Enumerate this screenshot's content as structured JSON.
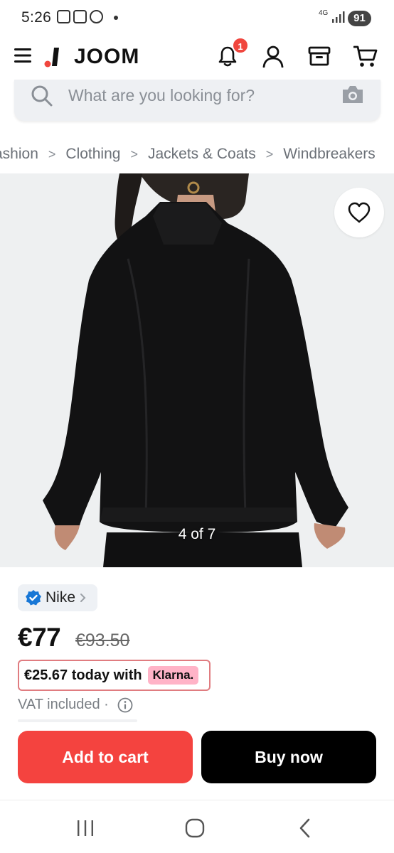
{
  "status_bar": {
    "time": "5:26",
    "network": "4G",
    "battery": "91"
  },
  "header": {
    "brand": "JOOM",
    "notification_count": "1"
  },
  "search": {
    "placeholder": "What are you looking for?"
  },
  "breadcrumbs": [
    "ashion",
    "Clothing",
    "Jackets & Coats",
    "Windbreakers"
  ],
  "gallery": {
    "counter": "4 of 7"
  },
  "product": {
    "brand": "Nike",
    "price": "€77",
    "old_price": "€93.50",
    "klarna_text": "€25.67 today with",
    "klarna_badge": "Klarna.",
    "vat_text": "VAT included ·"
  },
  "actions": {
    "add_to_cart": "Add to cart",
    "buy_now": "Buy now"
  },
  "colors": {
    "accent_red": "#f4433f",
    "badge_red": "#f0463e",
    "klarna_pink": "#ffb3c7",
    "verified_blue": "#1877d6"
  }
}
